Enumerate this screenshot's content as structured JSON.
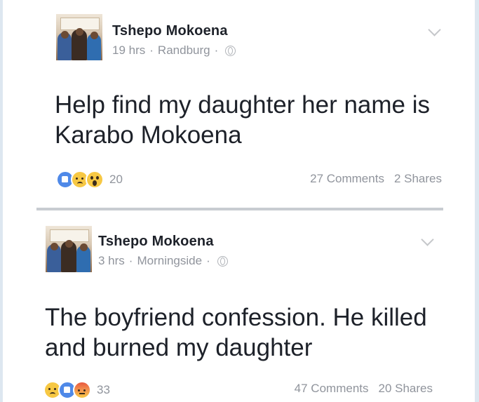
{
  "posts": [
    {
      "author": "Tshepo Mokoena",
      "time": "19 hrs",
      "location": "Randburg",
      "text": "Help find my daughter her name is Karabo Mokoena",
      "reactions": [
        "like-icon",
        "sad-icon",
        "wow-icon"
      ],
      "reaction_count": "20",
      "comments": "27 Comments",
      "shares": "2 Shares"
    },
    {
      "author": "Tshepo Mokoena",
      "time": "3 hrs",
      "location": "Morningside",
      "text": "The boyfriend confession. He killed and burned my daughter",
      "reactions": [
        "sad-icon",
        "like-icon",
        "angry-icon"
      ],
      "reaction_count": "33",
      "comments": "47 Comments",
      "shares": "20 Shares"
    }
  ],
  "colors": {
    "name": "#1d2129",
    "meta": "#90949c",
    "like": "#4f89e8",
    "divider": "#c8ccd1"
  }
}
